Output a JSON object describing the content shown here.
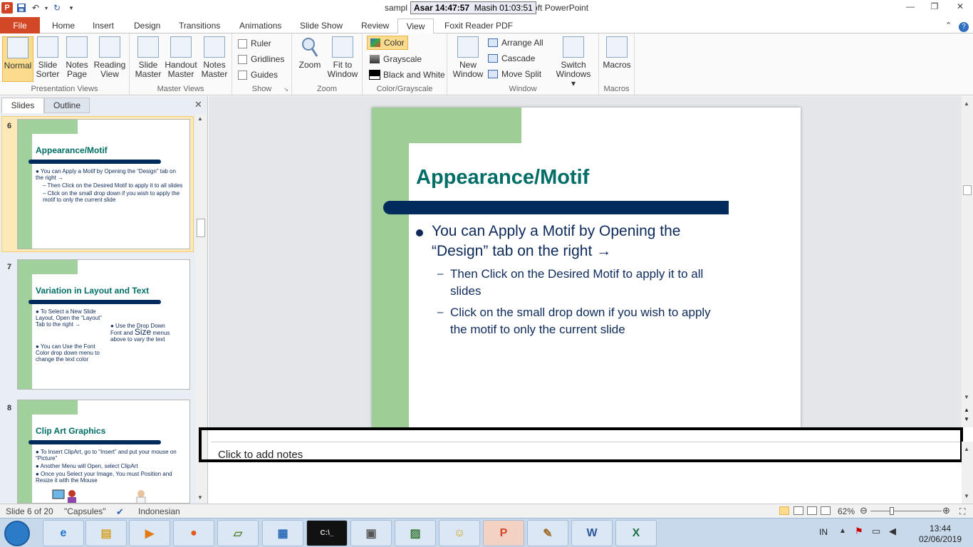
{
  "window": {
    "title_prefix": "sampl",
    "title_suffix": "oft PowerPoint",
    "tooltip_time": "Asar 14:47:57",
    "tooltip_remaining": "Masih 01:03:51"
  },
  "tabs": [
    "File",
    "Home",
    "Insert",
    "Design",
    "Transitions",
    "Animations",
    "Slide Show",
    "Review",
    "View",
    "Foxit Reader PDF"
  ],
  "ribbon": {
    "presentation_views": {
      "label": "Presentation Views",
      "buttons": [
        {
          "line1": "Normal",
          "line2": ""
        },
        {
          "line1": "Slide",
          "line2": "Sorter"
        },
        {
          "line1": "Notes",
          "line2": "Page"
        },
        {
          "line1": "Reading",
          "line2": "View"
        }
      ]
    },
    "master_views": {
      "label": "Master Views",
      "buttons": [
        {
          "line1": "Slide",
          "line2": "Master"
        },
        {
          "line1": "Handout",
          "line2": "Master"
        },
        {
          "line1": "Notes",
          "line2": "Master"
        }
      ]
    },
    "show": {
      "label": "Show",
      "items": [
        "Ruler",
        "Gridlines",
        "Guides"
      ]
    },
    "zoom": {
      "label": "Zoom",
      "zoom_btn": "Zoom",
      "fit_line1": "Fit to",
      "fit_line2": "Window"
    },
    "color": {
      "label": "Color/Grayscale",
      "items": [
        "Color",
        "Grayscale",
        "Black and White"
      ]
    },
    "window": {
      "label": "Window",
      "new_line1": "New",
      "new_line2": "Window",
      "items": [
        "Arrange All",
        "Cascade",
        "Move Split"
      ],
      "switch_line1": "Switch",
      "switch_line2": "Windows ▾"
    },
    "macros": {
      "label": "Macros",
      "btn": "Macros"
    }
  },
  "left_pane": {
    "tabs": [
      "Slides",
      "Outline"
    ],
    "slides": [
      {
        "num": "6",
        "title": "Appearance/Motif",
        "lines": [
          "● You can Apply a Motif by Opening the “Design” tab on the right →",
          "– Then Click on the Desired Motif to apply it to all slides",
          "– Click on the small drop down if you wish to apply the motif to only the current slide"
        ]
      },
      {
        "num": "7",
        "title": "Variation in Layout and Text",
        "left_lines": [
          "● To Select a New Slide Layout, Open the “Layout” Tab to the right →",
          "● You can Use the Font Color drop down menu to change the text color"
        ],
        "right_prefix": "● Use the Drop Down Font and",
        "right_big": "Size",
        "right_suffix": "menus above to vary the text"
      },
      {
        "num": "8",
        "title": "Clip Art Graphics",
        "lines": [
          "● To Insert ClipArt, go to “Insert” and put your mouse on “Picture”",
          "● Another Menu will Open, select ClipArt",
          "● Once you Select your Image, You must Position and Resize it with the Mouse"
        ]
      }
    ]
  },
  "slide": {
    "title": "Appearance/Motif",
    "bullet1_line1": "You can Apply a Motif by Opening the",
    "bullet1_line2": "“Design” tab on the right →",
    "sub1_line1": "Then Click on the Desired Motif to apply it to all",
    "sub1_line2": "slides",
    "sub2_line1": "Click on the small drop down if you wish to apply",
    "sub2_line2": "the motif to only the current slide"
  },
  "notes": {
    "placeholder": "Click to add notes"
  },
  "status": {
    "slide_pos": "Slide 6 of 20",
    "theme": "\"Capsules\"",
    "language": "Indonesian",
    "zoom": "62%"
  },
  "taskbar": {
    "lang": "IN",
    "time": "13:44",
    "date": "02/06/2019"
  },
  "colors": {
    "accent_green": "#9ecd96",
    "title_teal": "#006e66",
    "bar_navy": "#002b5c",
    "file_tab": "#d24726"
  }
}
